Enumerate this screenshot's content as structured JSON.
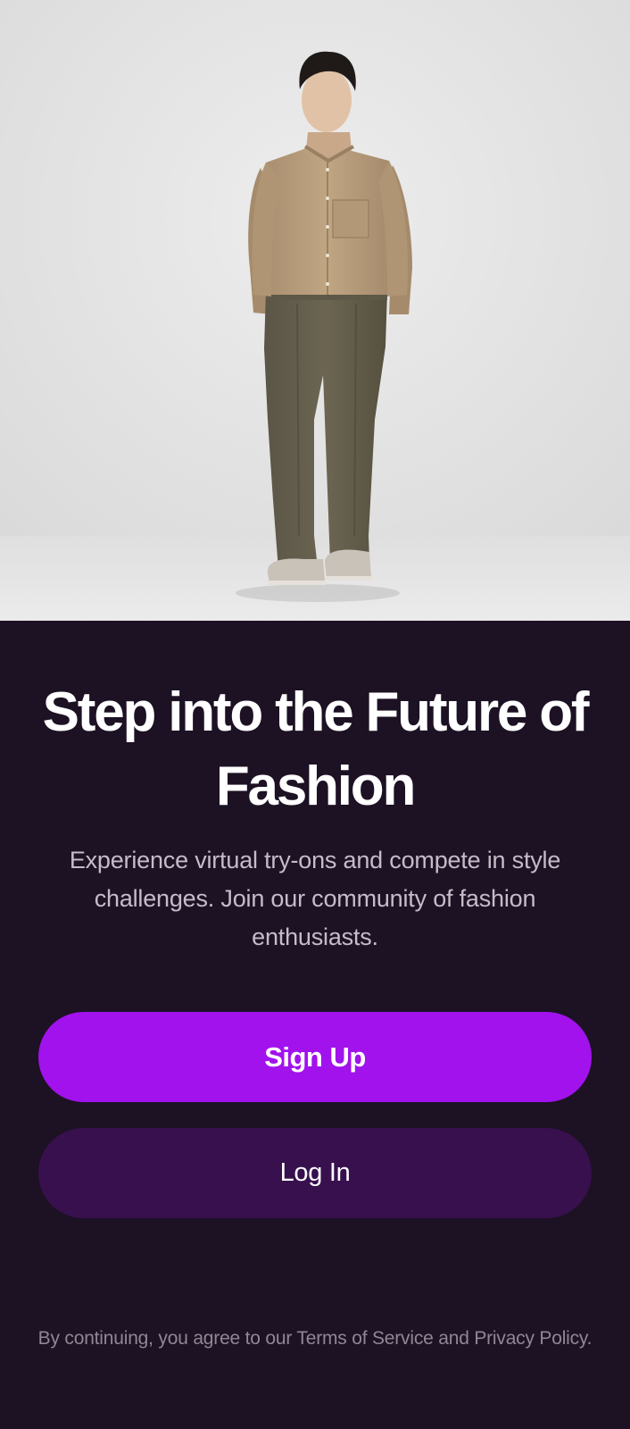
{
  "hero": {
    "image_alt": "model-wearing-tan-shirt-and-olive-trousers"
  },
  "headline": "Step into the Future of Fashion",
  "subtitle": "Experience virtual try-ons and compete in style challenges. Join our community of fashion enthusiasts.",
  "actions": {
    "sign_up_label": "Sign Up",
    "log_in_label": "Log In"
  },
  "legal": {
    "prefix": "By continuing, you agree to our ",
    "terms_link": "Terms of Service",
    "connector": " and ",
    "privacy_link": "Privacy Policy",
    "suffix": "."
  },
  "colors": {
    "background": "#1d1124",
    "primary_button": "#a112ed",
    "secondary_button": "#37104d",
    "heading_text": "#ffffff",
    "body_text": "#c4bcc8",
    "legal_text": "#8f8794"
  }
}
